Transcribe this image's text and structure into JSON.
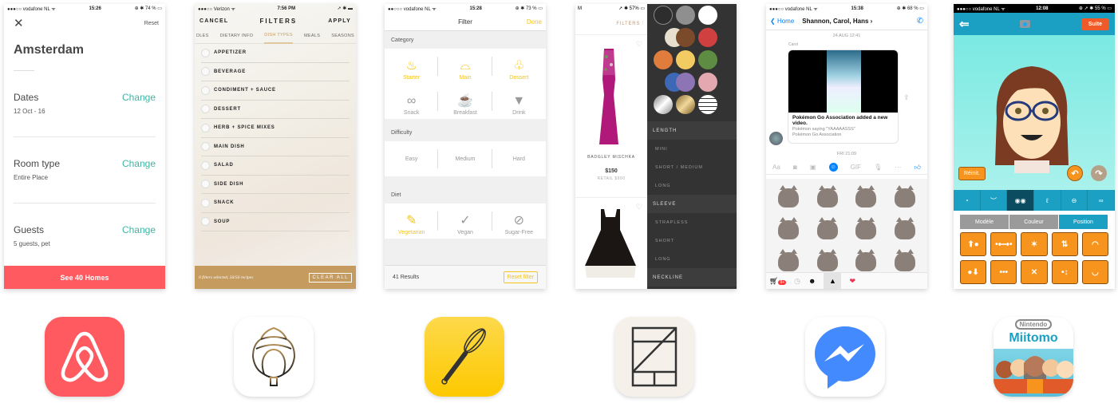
{
  "airbnb": {
    "status": {
      "carrier": "●●●○○ vodafone NL ᯤ",
      "time": "15:26",
      "battery": "⊕ ✱ 74 % ▭"
    },
    "reset_label": "Reset",
    "city": "Amsterdam",
    "sections": [
      {
        "label": "Dates",
        "value": "12 Oct - 16",
        "action": "Change"
      },
      {
        "label": "Room type",
        "value": "Entire Place",
        "action": "Change"
      },
      {
        "label": "Guests",
        "value": "5 guests, pet",
        "action": "Change"
      }
    ],
    "cta": "See 40 Homes",
    "accent": "#fe5a5f",
    "link_color": "#3fb5a4"
  },
  "artichoke": {
    "status": {
      "carrier": "●●●○○ Verizon ᯤ",
      "time": "7:56 PM",
      "battery": "➚ ✱ ▬"
    },
    "cancel": "CANCEL",
    "title": "FILTERS",
    "apply": "APPLY",
    "tabs": [
      "DLES",
      "DIETARY INFO",
      "DISH TYPES",
      "MEALS",
      "SEASONS"
    ],
    "active_tab": "DISH TYPES",
    "items": [
      "APPETIZER",
      "BEVERAGE",
      "CONDIMENT + SAUCE",
      "DESSERT",
      "HERB + SPICE MIXES",
      "MAIN DISH",
      "SALAD",
      "SIDE DISH",
      "SNACK",
      "SOUP"
    ],
    "footer_status": "0 filters selected, 56/56 recipes",
    "clear_all": "CLEAR ALL",
    "accent": "#c59b5f"
  },
  "kitchen": {
    "status": {
      "carrier": "●●○○○ vodafone NL ᯤ",
      "time": "15:28",
      "battery": "⊕ ✱ 73 % ▭"
    },
    "title": "Filter",
    "done": "Done",
    "category_heading": "Category",
    "categories": [
      {
        "label": "Starter",
        "icon": "soup-bowl-icon",
        "glyph": "♨",
        "selected": true
      },
      {
        "label": "Main",
        "icon": "cloche-icon",
        "glyph": "⌓",
        "selected": true
      },
      {
        "label": "Dessert",
        "icon": "muffin-icon",
        "glyph": "♧",
        "selected": true
      },
      {
        "label": "Snack",
        "icon": "pretzel-icon",
        "glyph": "∞",
        "selected": false
      },
      {
        "label": "Breakfast",
        "icon": "coffee-cup-icon",
        "glyph": "☕",
        "selected": false
      },
      {
        "label": "Drink",
        "icon": "glass-icon",
        "glyph": "▼",
        "selected": false
      }
    ],
    "difficulty_heading": "Difficulty",
    "difficulty": [
      "Easy",
      "Medium",
      "Hard"
    ],
    "diet_heading": "Diet",
    "diet": [
      {
        "label": "Vegetarian",
        "icon": "carrot-icon",
        "glyph": "✎",
        "selected": true
      },
      {
        "label": "Vegan",
        "icon": "leaf-icon",
        "glyph": "✓",
        "selected": false
      },
      {
        "label": "Sugar-Free",
        "icon": "no-sugar-icon",
        "glyph": "⊘",
        "selected": false
      }
    ],
    "results": "41 Results",
    "reset": "Reset filter",
    "accent": "#f5c518"
  },
  "moda": {
    "status": {
      "time": "M",
      "battery": "➚ ✱ 57% ▭"
    },
    "filters_label": "FILTERS",
    "products": [
      {
        "brand": "BADGLEY MISCHKA",
        "price": "$150",
        "retail": "RETAIL $990"
      }
    ],
    "swatches": [
      "#2d2d2d",
      "#8f8f8f",
      "#ffffff",
      "#e8e0cf",
      "#7a4a2a",
      "#d04040",
      "#e07d3c",
      "#f2cc62",
      "#5e8c42",
      "#3d68b5",
      "#8c74b5",
      "#e4a8b1",
      "silver",
      "gold",
      "pattern"
    ],
    "groups": [
      {
        "heading": "LENGTH",
        "options": [
          "MINI",
          "SHORT / MEDIUM",
          "LONG"
        ]
      },
      {
        "heading": "SLEEVE",
        "options": [
          "STRAPLESS",
          "SHORT",
          "LONG"
        ]
      },
      {
        "heading": "NECKLINE",
        "options": []
      }
    ]
  },
  "messenger": {
    "status": {
      "carrier": "●●●○○ vodafone NL ᯤ",
      "time": "15:38",
      "battery": "⊕ ✱ 68 % ▭"
    },
    "back": "Home",
    "title": "Shannon, Carol, Hans ›",
    "timestamp1": "24 AUG 12:41",
    "sender": "Carol",
    "card_title": "Pokémon Go Association added a new video.",
    "card_sub1": "Pokémon saying \"YAAAAASSS\"",
    "card_sub2": "Pokémon Go Association",
    "timestamp2": "FRI 21:09",
    "tools": [
      "Aa",
      "camera-icon",
      "photo-icon",
      "sticker-icon",
      "GIF",
      "mic-icon",
      "more-icon",
      "like-icon"
    ],
    "tray_badge": "9+",
    "accent": "#0084ff"
  },
  "miitomo": {
    "status": {
      "carrier": "●●●○○ vodafone NL ᯤ",
      "time": "12:08",
      "battery": "⊕ ➚ ✱ 55 % ▭"
    },
    "suite": "Suite",
    "reinit": "Réinit.",
    "parts": [
      "◔",
      "︶",
      "◉◉",
      "ℓ",
      "⊖",
      "∞"
    ],
    "active_part_index": 2,
    "segments": [
      "Modèle",
      "Couleur",
      "Position"
    ],
    "active_segment": "Position",
    "buttons_top": [
      "⬆●",
      "•⟷•",
      "✶",
      "⇅",
      "◠"
    ],
    "buttons_bottom": [
      "●⬇",
      "•••",
      "✕",
      "•↕",
      "◡"
    ]
  },
  "app_icons": [
    {
      "name": "Airbnb",
      "color": "#ff5a5f"
    },
    {
      "name": "Artichoke",
      "color": "#ffffff"
    },
    {
      "name": "Kitchen Stories",
      "color": "#fdd230"
    },
    {
      "name": "Moda Operandi",
      "color": "#f5f0ea"
    },
    {
      "name": "Messenger",
      "color": "#ffffff"
    },
    {
      "name": "Miitomo",
      "color": "#ffffff",
      "brand": "Nintendo",
      "label": "Miitomo"
    }
  ]
}
